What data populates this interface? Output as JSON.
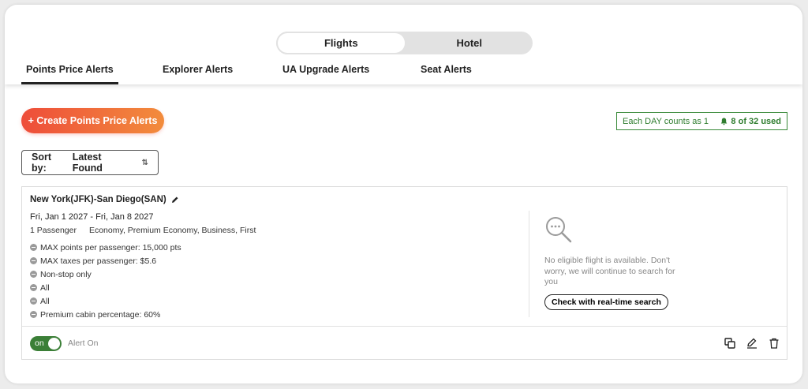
{
  "segments": [
    {
      "label": "Flights",
      "active": true
    },
    {
      "label": "Hotel",
      "active": false
    }
  ],
  "tabs": [
    {
      "label": "Points Price Alerts",
      "active": true
    },
    {
      "label": "Explorer Alerts",
      "active": false
    },
    {
      "label": "UA Upgrade Alerts",
      "active": false
    },
    {
      "label": "Seat Alerts",
      "active": false
    }
  ],
  "create_button": "+ Create Points Price Alerts",
  "quota": {
    "note": "Each DAY counts as 1",
    "used": "8 of 32 used"
  },
  "sort": {
    "label": "Sort by:",
    "value": "Latest Found"
  },
  "alert": {
    "route": "New York(JFK)-San Diego(SAN)",
    "dates": "Fri, Jan 1 2027 - Fri, Jan 8 2027",
    "passengers": "1 Passenger",
    "cabins": "Economy, Premium Economy, Business, First",
    "conditions": [
      "MAX points per passenger: 15,000 pts",
      "MAX taxes per passenger: $5.6",
      "Non-stop only",
      "All",
      "All",
      "Premium cabin percentage: 60%"
    ],
    "empty_message": "No eligible flight is available. Don't worry, we will continue to search for you",
    "realtime_button": "Check with real-time search",
    "toggle_label": "on",
    "status": "Alert On"
  },
  "colors": {
    "accent_green": "#3b7f37",
    "gradient_start": "#ee4d3a",
    "gradient_end": "#f28c3c"
  }
}
